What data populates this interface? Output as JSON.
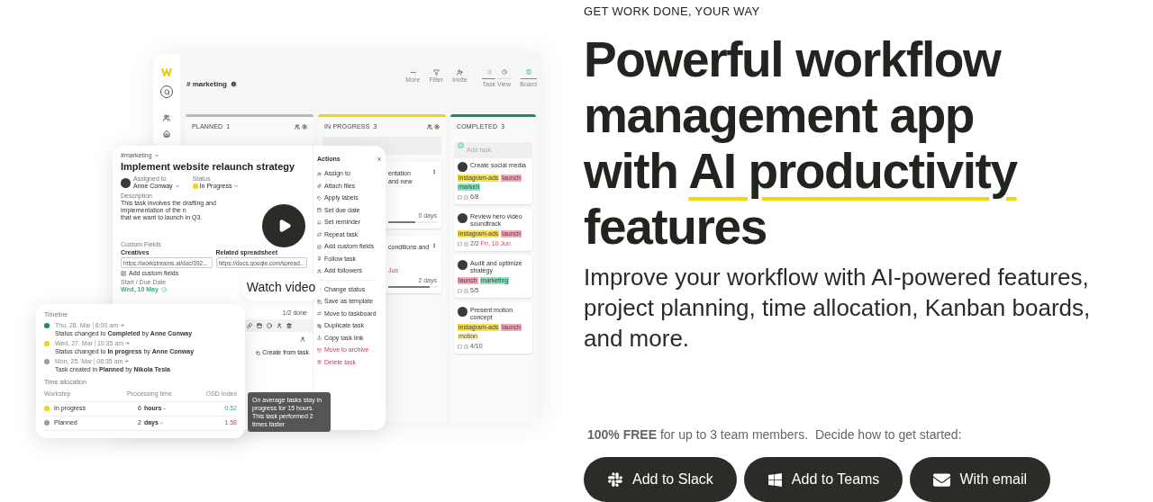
{
  "app": {
    "channel": "# marketing",
    "toolbar": [
      {
        "label": "More"
      },
      {
        "label": "Filter"
      },
      {
        "label": "Invite"
      }
    ],
    "view_tabs": {
      "label": "Task View",
      "tabs": [
        {
          "kind": "tasks",
          "selected": true
        },
        {
          "kind": "clock",
          "selected": false
        }
      ]
    },
    "board_tab": {
      "label": "Board",
      "selected": true
    },
    "columns": [
      {
        "title": "PLANNED",
        "count": "1",
        "color": "#b8b8b8"
      },
      {
        "title": "IN PROGRESS",
        "count": "3",
        "color": "#f2d60c"
      },
      {
        "title": "COMPLETED",
        "count": "3",
        "color": "#1f8a5b"
      }
    ],
    "in_progress_cards": [
      {
        "lines": [
          "entation",
          "and new"
        ],
        "duration": "0 days",
        "level": 0.55
      },
      {
        "lines": [
          "conditions and"
        ],
        "due": "Jun",
        "duration": "2 days",
        "level": 0.85
      }
    ],
    "add_task": {
      "placeholder": "Add task"
    },
    "completed_cards": [
      {
        "lines": [
          "Create social media"
        ],
        "tags": [
          {
            "label": "instagram-ads",
            "color": "#f7e14a"
          },
          {
            "label": "launch",
            "color": "#f4a9bb"
          },
          {
            "label": "marketi",
            "color": "#8fe3bf"
          }
        ],
        "count": "6/8"
      },
      {
        "lines": [
          "Review hero video",
          "soundtrack"
        ],
        "tags": [
          {
            "label": "instagram-ads",
            "color": "#f7e14a"
          },
          {
            "label": "launch",
            "color": "#f4a9bb"
          }
        ],
        "count": "2/2",
        "due": "Fri, 10 Jun"
      },
      {
        "lines": [
          "Audit and optimize",
          "strategy"
        ],
        "tags": [
          {
            "label": "launch",
            "color": "#f4a9bb"
          },
          {
            "label": "marketing",
            "color": "#8fe3bf"
          }
        ],
        "count": "5/5"
      },
      {
        "lines": [
          "Present motion",
          "concept"
        ],
        "tags": [
          {
            "label": "instagram-ads",
            "color": "#f7e14a"
          },
          {
            "label": "launch",
            "color": "#f4a9bb"
          },
          {
            "label": "motion",
            "color": "#fbf3c4"
          }
        ],
        "count": "4/10"
      }
    ]
  },
  "task": {
    "breadcrumb": "#marketing",
    "title": "Implement website relaunch strategy",
    "assigned_label": "Assigned to",
    "assignee": "Anne Conway",
    "status_label": "Status",
    "status": "In Progress",
    "description_label": "Description",
    "description_lines": [
      "This task involves the drafting and implementation of the n",
      "that we want to launch in Q3."
    ],
    "custom_fields_label": "Custom Fields",
    "fields": [
      {
        "label": "Creatives",
        "value": "https://workstreams.ai/doc/392..."
      },
      {
        "label": "Related spreadsheet",
        "value": "https://docs.google.com/spread..."
      }
    ],
    "add_custom_fields": "Add custom fields",
    "dates_label": "Start / Due Date",
    "date": "Wed, 10 May",
    "subtasks_done": "1/2 done",
    "create_from_task": "Create from task"
  },
  "actions": {
    "title": "Actions",
    "items": [
      {
        "label": "Assign to",
        "danger": false
      },
      {
        "label": "Attach files",
        "danger": false
      },
      {
        "label": "Apply labels",
        "danger": false
      },
      {
        "label": "Set due date",
        "danger": false
      },
      {
        "label": "Set reminder",
        "danger": false
      },
      {
        "label": "Repeat task",
        "danger": false
      },
      {
        "label": "Add custom fields",
        "danger": false
      },
      {
        "label": "Follow task",
        "danger": false
      },
      {
        "label": "Add followers",
        "danger": false
      },
      {
        "label": "Change status",
        "danger": false
      },
      {
        "label": "Save as template",
        "danger": false
      },
      {
        "label": "Move to taskboard",
        "danger": false
      },
      {
        "label": "Duplicate task",
        "danger": false
      },
      {
        "label": "Copy task link",
        "danger": false
      },
      {
        "label": "Move to archive",
        "danger": true
      },
      {
        "label": "Delete task",
        "danger": true
      }
    ]
  },
  "video": {
    "label": "Watch video"
  },
  "timeline": {
    "title": "Timeline",
    "events": [
      {
        "date": "Thu, 28. Mar",
        "time": "8:00 am",
        "text": "Status changed to **Completed** by **Anne Conway**",
        "color": "#1f8a5b"
      },
      {
        "date": "Wed, 27. Mar",
        "time": "10:35 am",
        "text": "Status changed to **In progress** by **Anne Conway**",
        "color": "#f2d60c"
      },
      {
        "date": "Mon, 25. Mar",
        "time": "08:35 am",
        "text": "Task created in **Planned** by **Nikola Tesla**",
        "color": "#9a9a9a"
      }
    ],
    "allocation_title": "Time allocation",
    "columns": [
      "Workstep",
      "Processing time",
      "OSD Index"
    ],
    "rows": [
      {
        "step": "In progress",
        "amount": "6",
        "unit": "hours",
        "index": "0.52",
        "color": "#f2d60c",
        "faster": true
      },
      {
        "step": "Planned",
        "amount": "2",
        "unit": "days",
        "index": "1.58",
        "color": "#9a9a9a",
        "faster": false
      }
    ]
  },
  "tooltip": "On average tasks stay in progress for 15 hours. This task performed 2 times faster",
  "hero": {
    "eyebrow": "GET WORK DONE, YOUR WAY",
    "heading_lines": [
      [
        {
          "text": "Powerful workflow",
          "underline": false
        }
      ],
      [
        {
          "text": "management app",
          "underline": false
        }
      ],
      [
        {
          "text": "with ",
          "underline": false
        },
        {
          "text": "AI productivity",
          "underline": true
        }
      ],
      [
        {
          "text": "features",
          "underline": false
        }
      ]
    ],
    "subtitle": "Improve your workflow with AI-powered features, project planning, time allocation, Kanban boards, and more.",
    "note": "**100% FREE** for up to 3 team members.  Decide how to get started:",
    "buttons": [
      {
        "kind": "slack",
        "label": "Add to Slack"
      },
      {
        "kind": "teams",
        "label": "Add to Teams"
      },
      {
        "kind": "email",
        "label": "With email"
      }
    ]
  }
}
